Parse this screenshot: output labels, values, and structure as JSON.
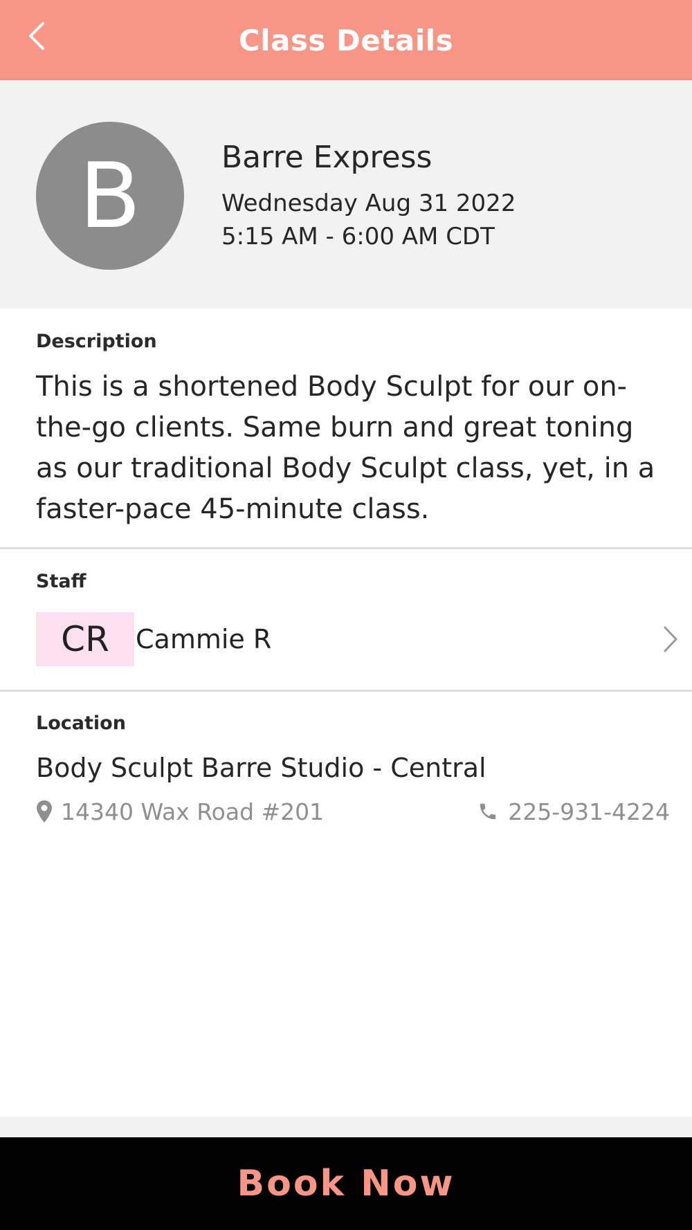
{
  "header": {
    "title": "Class Details",
    "back_icon": "chevron-left-icon"
  },
  "class": {
    "avatar_letter": "B",
    "name": "Barre Express",
    "date": "Wednesday Aug 31 2022",
    "time": "5:15 AM - 6:00 AM CDT"
  },
  "description": {
    "label": "Description",
    "text": "This is a shortened Body Sculpt for our on-the-go clients. Same burn and great toning as our traditional Body Sculpt class, yet, in a faster-pace 45-minute class."
  },
  "staff": {
    "label": "Staff",
    "initials": "CR",
    "name": "Cammie R",
    "chevron_icon": "chevron-right-icon"
  },
  "location": {
    "label": "Location",
    "name": "Body Sculpt Barre Studio - Central",
    "address": "14340 Wax Road #201",
    "address_icon": "map-pin-icon",
    "phone": "225-931-4224",
    "phone_icon": "phone-icon"
  },
  "footer": {
    "book_label": "Book Now"
  },
  "colors": {
    "accent": "#f79686",
    "hero_bg": "#f2f2f2",
    "avatar_bg": "#8c8c8c",
    "staff_initials_bg": "#fde0ef",
    "book_bar_bg": "#000000",
    "muted_text": "#8f8f8f"
  }
}
